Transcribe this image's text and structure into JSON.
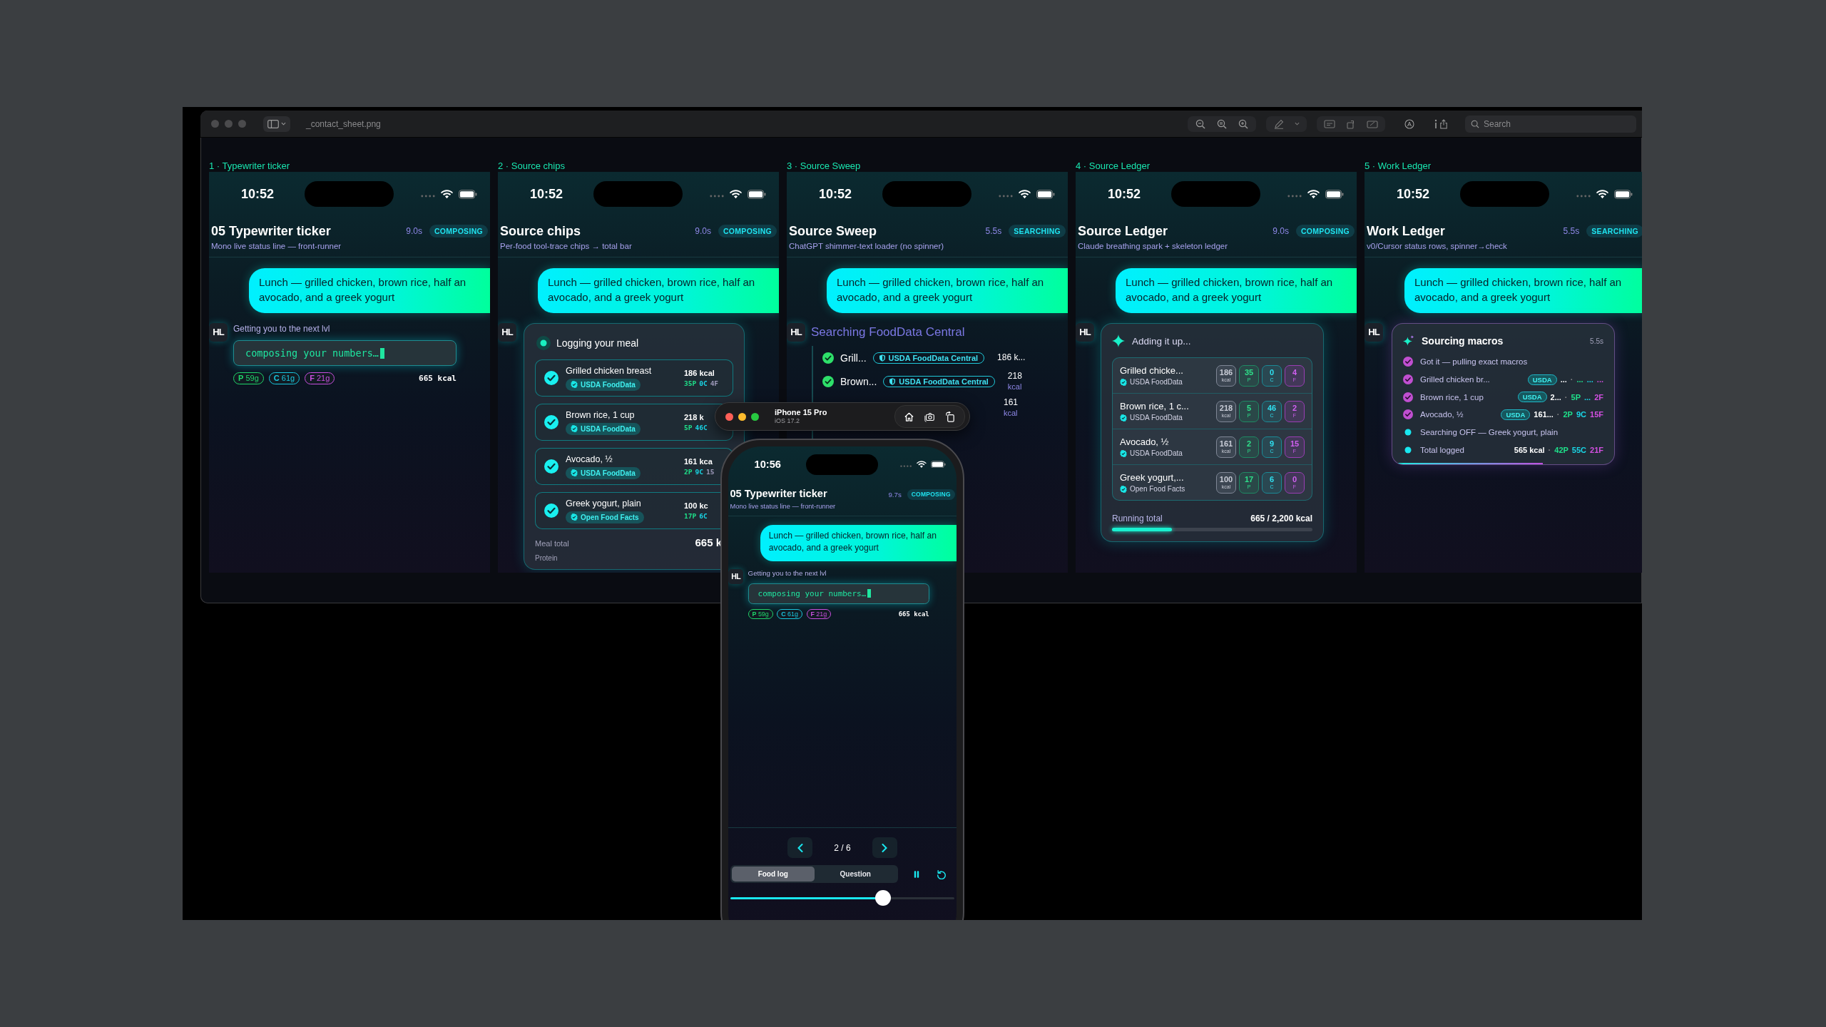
{
  "viewer": {
    "title": "_contact_sheet.png",
    "search": {
      "placeholder": "Search"
    }
  },
  "panels": [
    {
      "kind": "ticker",
      "label": "1 · Typewriter ticker",
      "time": "10:52",
      "title": "05 Typewriter ticker",
      "elapsed": "9.0s",
      "status": "COMPOSING",
      "subtitle": "Mono live status line — front-runner",
      "message": "Lunch — grilled chicken, brown rice, half an avocado, and a greek yogurt",
      "avatar": "HL",
      "assistant_label": "Getting you to the next lvl",
      "ticker": "composing your numbers…",
      "chips": [
        {
          "letter": "P",
          "amount": "59g",
          "color": "#1fd66a"
        },
        {
          "letter": "C",
          "amount": "61g",
          "color": "#19c8e0"
        },
        {
          "letter": "F",
          "amount": "21g",
          "color": "#c94fe0"
        }
      ],
      "total": "665 kcal"
    },
    {
      "kind": "chips",
      "label": "2 · Source chips",
      "time": "10:52",
      "title": "Source chips",
      "elapsed": "9.0s",
      "status": "COMPOSING",
      "subtitle": "Per-food tool-trace chips → total bar",
      "message": "Lunch — grilled chicken, brown rice, half an avocado, and a greek yogurt",
      "avatar": "HL",
      "heading": "Logging your meal",
      "rows": [
        {
          "name": "Grilled chicken breast",
          "source": "USDA FoodData",
          "kcal": "186 kcal",
          "macros": [
            "35P",
            "0C",
            "4F"
          ],
          "checked": true
        },
        {
          "name": "Brown rice, 1 cup",
          "source": "USDA FoodData",
          "kcal": "218 k",
          "macros": [
            "5P",
            "46C"
          ],
          "checked": true
        },
        {
          "name": "Avocado, ½",
          "source": "USDA FoodData",
          "kcal": "161 kca",
          "macros": [
            "2P",
            "9C",
            "15"
          ],
          "checked": true
        },
        {
          "name": "Greek yogurt, plain",
          "source": "Open Food Facts",
          "kcal": "100 kc",
          "macros": [
            "17P",
            "6C"
          ],
          "checked": true
        }
      ],
      "total_label": "Meal total",
      "total": "665 k",
      "next_label": "Protein"
    },
    {
      "kind": "sweep",
      "label": "3 · Source Sweep",
      "time": "10:52",
      "title": "Source Sweep",
      "elapsed": "5.5s",
      "status": "SEARCHING",
      "subtitle": "ChatGPT shimmer-text loader (no spinner)",
      "message": "Lunch — grilled chicken, brown rice, half an avocado, and a greek yogurt",
      "avatar": "HL",
      "heading": "Searching FoodData Central",
      "rows": [
        {
          "name": "Grill...",
          "source": "USDA FoodData Central",
          "kcal": "186 k...",
          "checked": true
        },
        {
          "name": "Brown...",
          "source": "USDA FoodData Central",
          "kcal": "218",
          "unit": "kcal",
          "checked": true
        }
      ],
      "partial_row": {
        "kcal": "161",
        "unit": "kcal"
      }
    },
    {
      "kind": "ledger",
      "label": "4 · Source Ledger",
      "time": "10:52",
      "title": "Source Ledger",
      "elapsed": "9.0s",
      "status": "COMPOSING",
      "subtitle": "Claude breathing spark + skeleton ledger",
      "message": "Lunch — grilled chicken, brown rice, half an avocado, and a greek yogurt",
      "avatar": "HL",
      "heading": "Adding it up...",
      "rows": [
        {
          "name": "Grilled chicke...",
          "source": "USDA FoodData",
          "cells": [
            {
              "value": "186",
              "unit": "kcal"
            },
            {
              "value": "35",
              "unit": "P"
            },
            {
              "value": "0",
              "unit": "C"
            },
            {
              "value": "4",
              "unit": "F"
            }
          ]
        },
        {
          "name": "Brown rice, 1 c...",
          "source": "USDA FoodData",
          "cells": [
            {
              "value": "218",
              "unit": "kcal"
            },
            {
              "value": "5",
              "unit": "P"
            },
            {
              "value": "46",
              "unit": "C"
            },
            {
              "value": "2",
              "unit": "F"
            }
          ]
        },
        {
          "name": "Avocado, ½",
          "source": "USDA FoodData",
          "cells": [
            {
              "value": "161",
              "unit": "kcal"
            },
            {
              "value": "2",
              "unit": "P"
            },
            {
              "value": "9",
              "unit": "C"
            },
            {
              "value": "15",
              "unit": "F"
            }
          ]
        },
        {
          "name": "Greek yogurt,...",
          "source": "Open Food Facts",
          "cells": [
            {
              "value": "100",
              "unit": "kcal"
            },
            {
              "value": "17",
              "unit": "P"
            },
            {
              "value": "6",
              "unit": "C"
            },
            {
              "value": "0",
              "unit": "F"
            }
          ]
        }
      ],
      "total_label": "Running total",
      "total": "665 / 2,200 kcal",
      "level": 0.3
    },
    {
      "kind": "worklist",
      "label": "5 · Work Ledger",
      "time": "10:52",
      "title": "Work Ledger",
      "elapsed": "5.5s",
      "status": "SEARCHING",
      "subtitle": "v0/Cursor status rows, spinner→check",
      "message": "Lunch — grilled chicken, brown rice, half an avocado, and a greek yogurt",
      "avatar": "HL",
      "heading": "Sourcing macros",
      "heading_time": "5.5s",
      "rows": [
        {
          "kind": "done",
          "text": "Got it — pulling exact macros"
        },
        {
          "kind": "done",
          "text": "Grilled chicken br...",
          "source": "USDA",
          "tail": [
            {
              "kind": "kcal",
              "text": "..."
            },
            {
              "kind": "sep",
              "text": "·"
            },
            {
              "kind": "p",
              "text": "..."
            },
            {
              "kind": "c",
              "text": "..."
            },
            {
              "kind": "f",
              "text": "..."
            }
          ]
        },
        {
          "kind": "done",
          "text": "Brown rice, 1 cup",
          "source": "USDA",
          "tail": [
            {
              "kind": "kcal",
              "text": "2..."
            },
            {
              "kind": "sep",
              "text": "·"
            },
            {
              "kind": "p",
              "text": "5P"
            },
            {
              "kind": "c",
              "text": "..."
            },
            {
              "kind": "f",
              "text": "2F"
            }
          ]
        },
        {
          "kind": "done",
          "text": "Avocado, ½",
          "source": "USDA",
          "tail": [
            {
              "kind": "kcal",
              "text": "161..."
            },
            {
              "kind": "sep",
              "text": "·"
            },
            {
              "kind": "p",
              "text": "2P"
            },
            {
              "kind": "c",
              "text": "9C"
            },
            {
              "kind": "f",
              "text": "15F"
            }
          ]
        },
        {
          "kind": "active",
          "text": "Searching OFF — Greek yogurt, plain"
        },
        {
          "kind": "active",
          "text": "Total logged",
          "tail": [
            {
              "kind": "kcal",
              "text": "565 kcal"
            },
            {
              "kind": "sep",
              "text": "·"
            },
            {
              "kind": "p",
              "text": "42P"
            },
            {
              "kind": "c",
              "text": "55C"
            },
            {
              "kind": "f",
              "text": "21F"
            }
          ]
        }
      ],
      "level": 0.68
    }
  ],
  "simulator": {
    "device": "iPhone 15 Pro",
    "os": "iOS 17.2",
    "screen": {
      "kind": "ticker",
      "time": "10:56",
      "title": "05 Typewriter ticker",
      "elapsed": "9.7s",
      "status": "COMPOSING",
      "subtitle": "Mono live status line — front-runner",
      "message": "Lunch — grilled chicken, brown rice, half an avocado, and a greek yogurt",
      "avatar": "HL",
      "assistant_label": "Getting you to the next lvl",
      "ticker": "composing your numbers…",
      "chips": [
        {
          "letter": "P",
          "amount": "59g",
          "color": "#1fd66a"
        },
        {
          "letter": "C",
          "amount": "61g",
          "color": "#19c8e0"
        },
        {
          "letter": "F",
          "amount": "21g",
          "color": "#c94fe0"
        }
      ],
      "total": "665 kcal"
    },
    "pager": "2 / 6",
    "modes": [
      {
        "label": "Food log",
        "selected": true
      },
      {
        "label": "Question",
        "selected": false
      }
    ],
    "scrubber": {
      "level": 0.68
    }
  }
}
